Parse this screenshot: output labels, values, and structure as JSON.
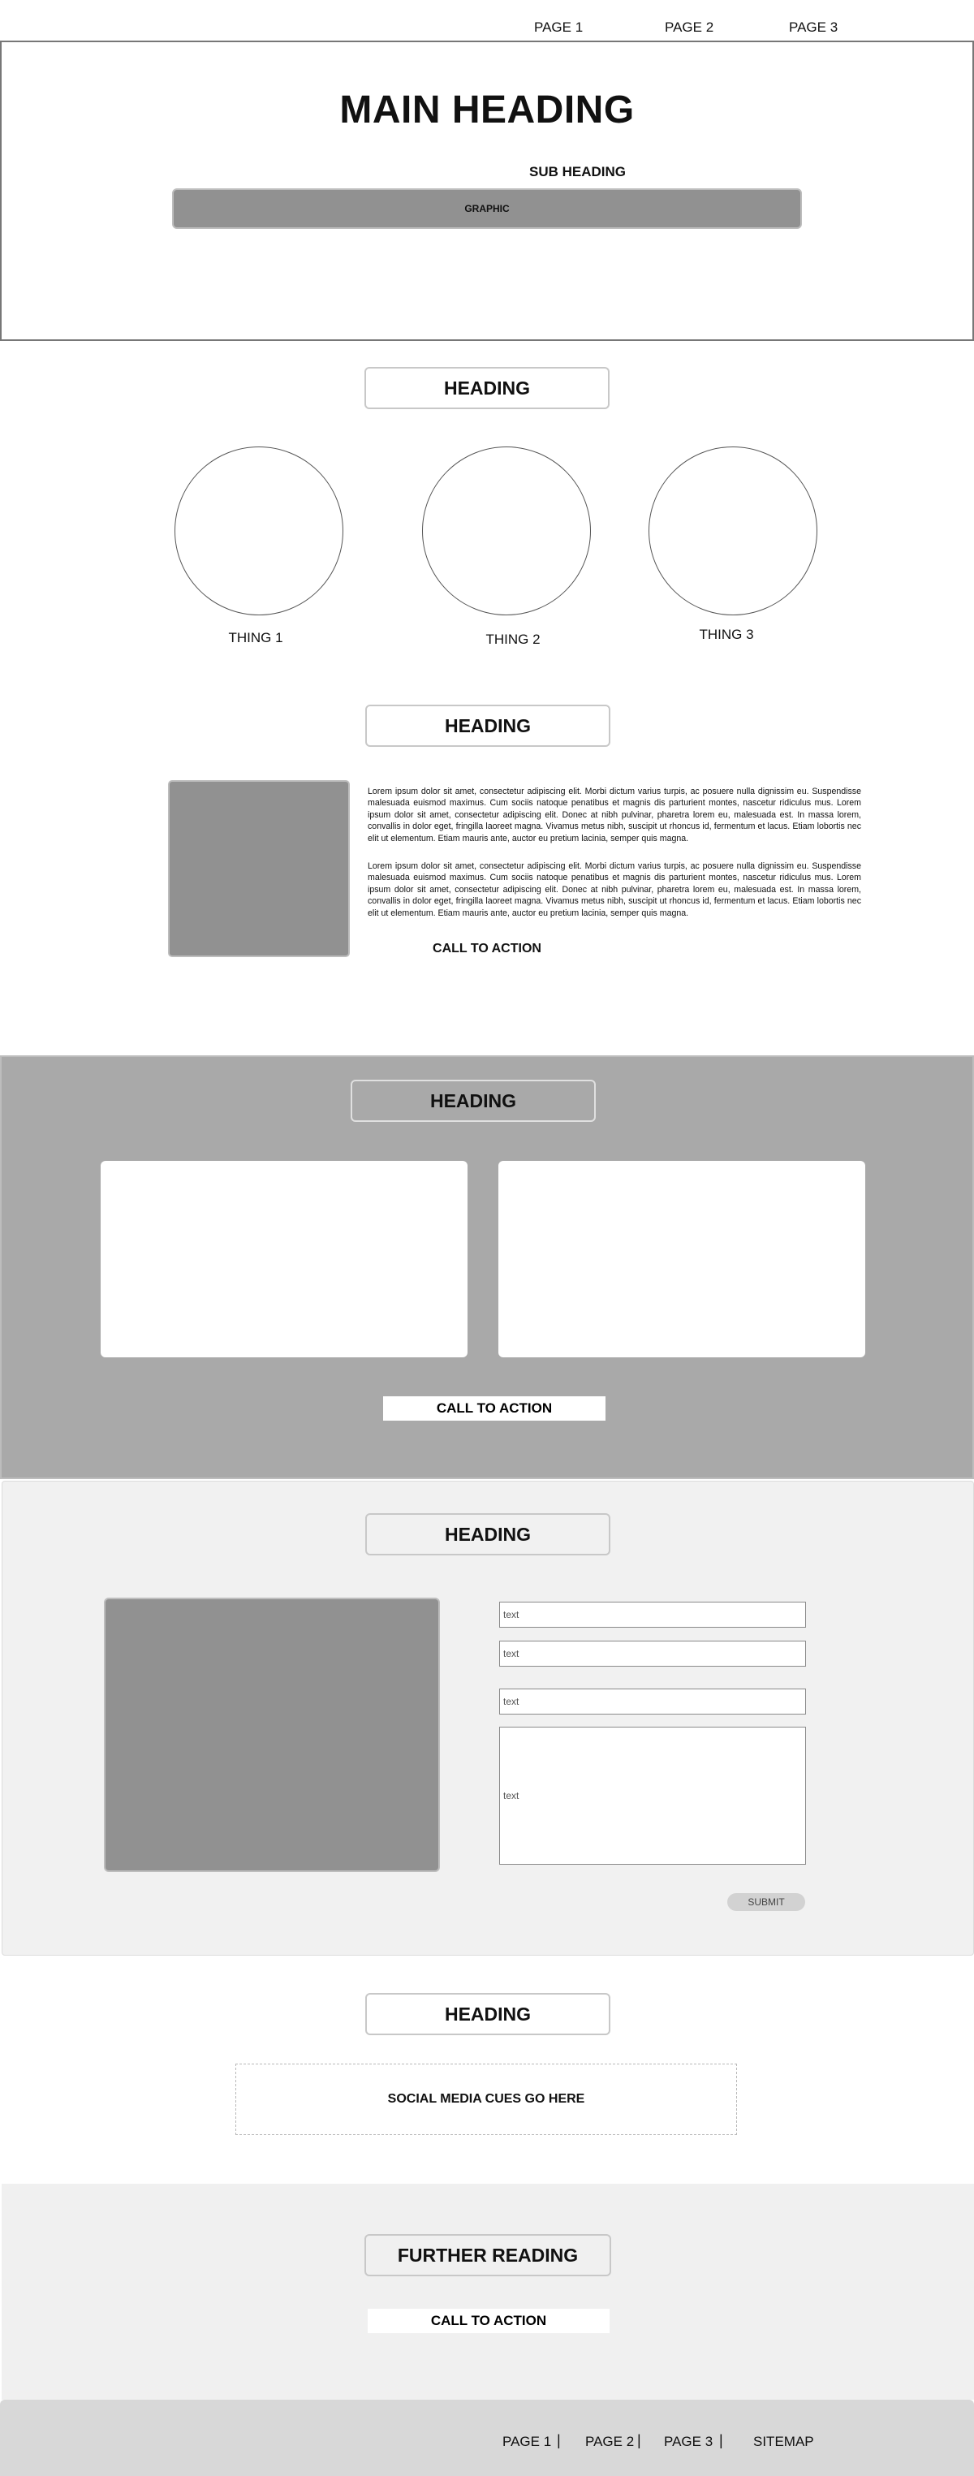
{
  "nav": {
    "items": [
      "PAGE 1",
      "PAGE 2",
      "PAGE 3"
    ]
  },
  "hero": {
    "title": "MAIN HEADING",
    "subtitle": "SUB HEADING",
    "graphic_label": "GRAPHIC"
  },
  "features": {
    "heading": "HEADING",
    "things": [
      "THING 1",
      "THING 2",
      "THING 3"
    ]
  },
  "about": {
    "heading": "HEADING",
    "paragraphs": [
      "Lorem ipsum dolor sit amet, consectetur adipiscing elit. Morbi dictum varius turpis, ac posuere nulla dignissim eu. Suspendisse malesuada euismod maximus. Cum sociis natoque penatibus et magnis dis parturient montes, nascetur ridiculus mus. Lorem ipsum dolor sit amet, consectetur adipiscing elit. Donec at nibh pulvinar, pharetra lorem eu, malesuada est. In massa lorem, convallis in dolor eget, fringilla laoreet magna. Vivamus metus nibh, suscipit ut rhoncus id, fermentum et lacus. Etiam lobortis nec elit ut elementum. Etiam mauris ante, auctor eu pretium lacinia, semper quis magna.",
      "Lorem ipsum dolor sit amet, consectetur adipiscing elit. Morbi dictum varius turpis, ac posuere nulla dignissim eu. Suspendisse malesuada euismod maximus. Cum sociis natoque penatibus et magnis dis parturient montes, nascetur ridiculus mus. Lorem ipsum dolor sit amet, consectetur adipiscing elit. Donec at nibh pulvinar, pharetra lorem eu, malesuada est. In massa lorem, convallis in dolor eget, fringilla laoreet magna. Vivamus metus nibh, suscipit ut rhoncus id, fermentum et lacus. Etiam lobortis nec elit ut elementum. Etiam mauris ante, auctor eu pretium lacinia, semper quis magna."
    ],
    "cta": "CALL TO ACTION"
  },
  "cards_section": {
    "heading": "HEADING",
    "cta": "CALL TO ACTION"
  },
  "contact": {
    "heading": "HEADING",
    "fields": [
      "text",
      "text",
      "text"
    ],
    "message_placeholder": "text",
    "submit": "SUBMIT"
  },
  "social": {
    "heading": "HEADING",
    "placeholder": "SOCIAL MEDIA CUES GO HERE"
  },
  "further": {
    "heading": "FURTHER READING",
    "cta": "CALL TO ACTION"
  },
  "footer": {
    "items": [
      "PAGE 1",
      "PAGE 2",
      "PAGE 3",
      "SITEMAP"
    ],
    "separator": "|"
  }
}
